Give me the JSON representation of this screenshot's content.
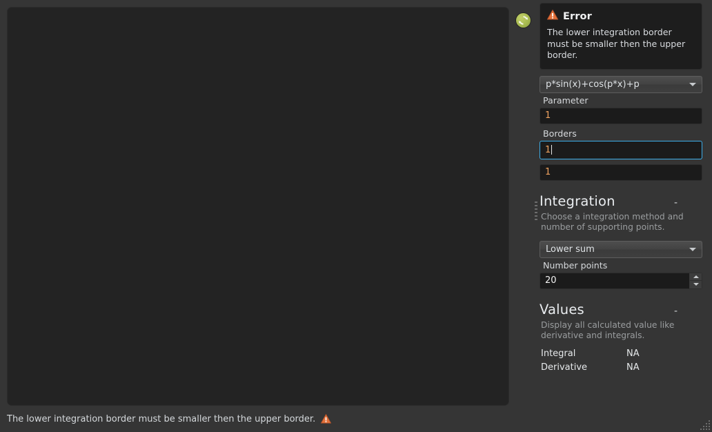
{
  "theme": {
    "window_bg": "#353535",
    "canvas_bg": "#232323",
    "input_bg": "#1b1b1b",
    "focus_border": "#3daee9",
    "value_text": "#f0a360",
    "accent_warning": "#e2713a",
    "refresh_green": "#a5b84e"
  },
  "plot": {
    "name": "function-plot-canvas",
    "content": ""
  },
  "refresh": {
    "icon": "refresh-icon",
    "tooltip": ""
  },
  "error": {
    "icon": "warning-triangle-icon",
    "title": "Error",
    "message": "The lower integration border must be smaller then the upper border."
  },
  "function": {
    "selected": "p*sin(x)+cos(p*x)+p",
    "arrow_icon": "chevron-down-icon"
  },
  "parameter": {
    "label": "Parameter",
    "value": "1"
  },
  "borders": {
    "label": "Borders",
    "lower_value": "1",
    "upper_value": "1"
  },
  "integration": {
    "title": "Integration",
    "toggle": "-",
    "description": "Choose a integration method and number of supporting points.",
    "method_selected": "Lower sum",
    "method_arrow_icon": "chevron-down-icon",
    "points_label": "Number points",
    "points_value": "20",
    "spin_up_icon": "triangle-up-icon",
    "spin_down_icon": "triangle-down-icon"
  },
  "values": {
    "title": "Values",
    "toggle": "-",
    "description": "Display all calculated value like derivative and integrals.",
    "rows": [
      {
        "label": "Integral",
        "value": "NA"
      },
      {
        "label": "Derivative",
        "value": "NA"
      }
    ]
  },
  "status_bar": {
    "message": "The lower integration border must be smaller then the upper border.",
    "icon": "warning-triangle-icon"
  }
}
